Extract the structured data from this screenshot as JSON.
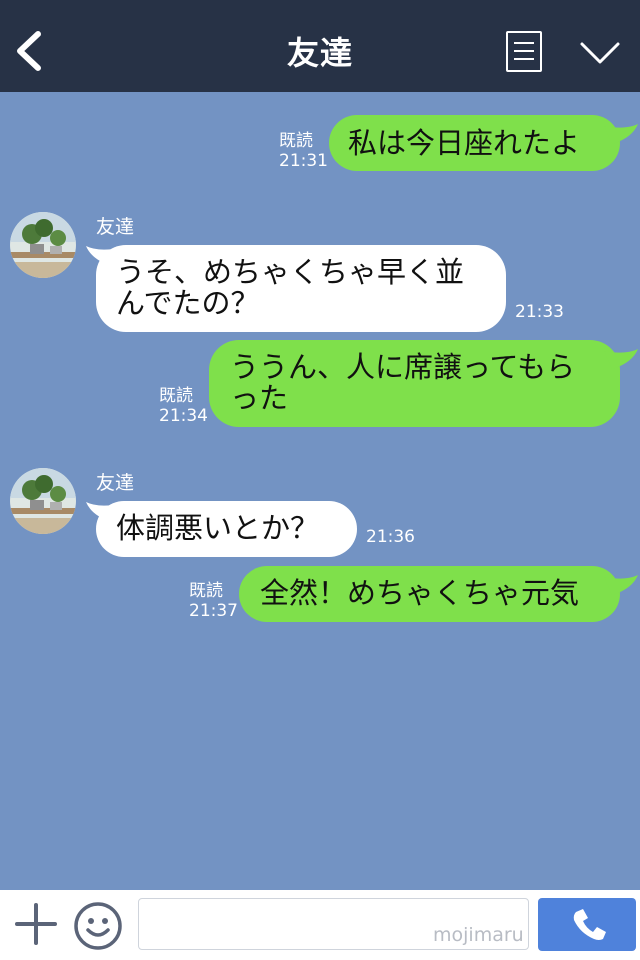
{
  "header": {
    "title": "友達",
    "back_icon": "chevron-left-icon",
    "menu_icon": "notes-icon",
    "collapse_icon": "chevron-down-icon",
    "background": "#273246"
  },
  "chat": {
    "background": "#7393c3",
    "messages": [
      {
        "direction": "out",
        "text_lines": [
          "私は今日座れたよ"
        ],
        "read": "既読",
        "time": "21:31"
      },
      {
        "direction": "in",
        "sender": "友達",
        "text_lines": [
          "うそ、めちゃくちゃ早く並",
          "んでたの？"
        ],
        "time": "21:33"
      },
      {
        "direction": "out",
        "text_lines": [
          "ううん、人に席譲ってもら",
          "った"
        ],
        "read": "既読",
        "time": "21:34"
      },
      {
        "direction": "in",
        "sender": "友達",
        "text_lines": [
          "体調悪いとか？"
        ],
        "time": "21:36"
      },
      {
        "direction": "out",
        "text_lines": [
          "全然！めちゃくちゃ元気"
        ],
        "read": "既読",
        "time": "21:37"
      }
    ],
    "out_bubble_color": "#7fe04b",
    "in_bubble_color": "#ffffff"
  },
  "footer": {
    "plus_icon": "plus-icon",
    "emoji_icon": "smile-icon",
    "input_value": "",
    "watermark": "mojimaru",
    "call_icon": "phone-icon",
    "call_button_color": "#4f82db"
  }
}
